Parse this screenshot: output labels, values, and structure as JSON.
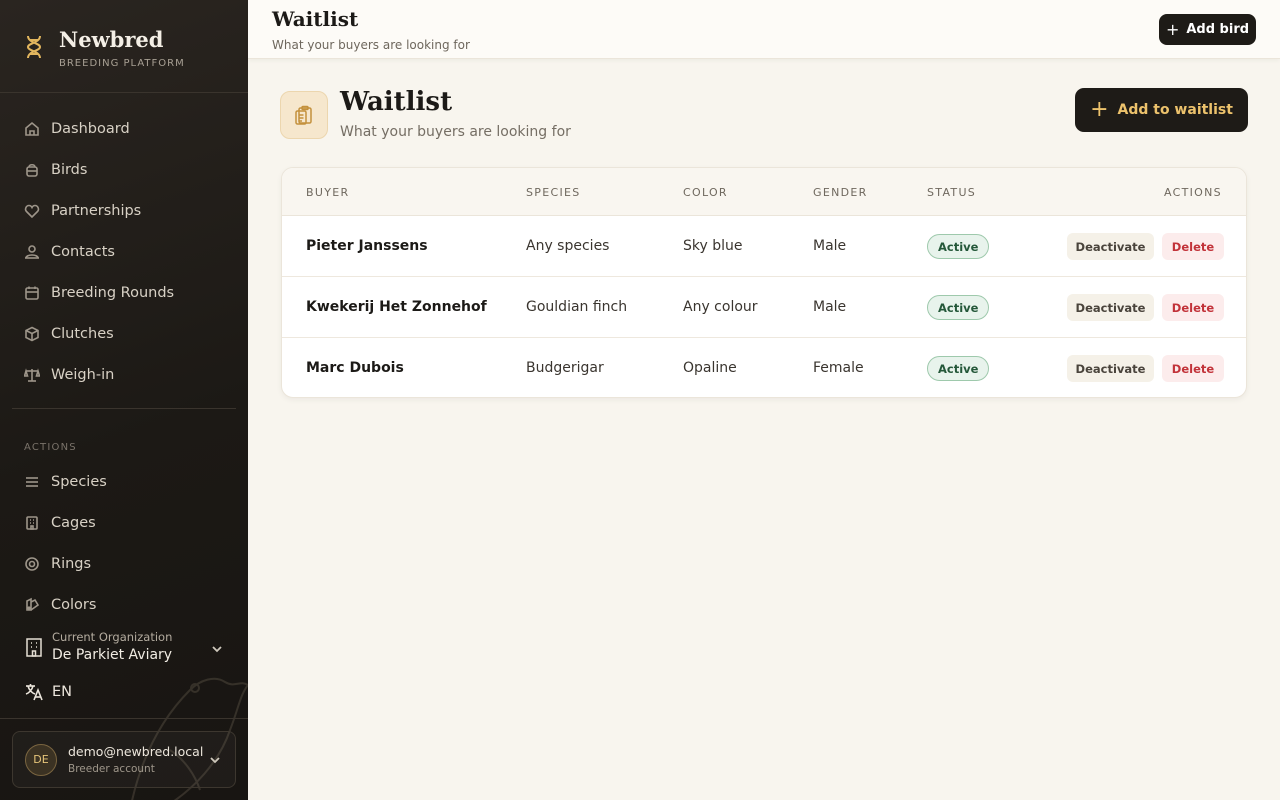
{
  "brand": {
    "name": "Newbred",
    "subtitle": "BREEDING PLATFORM"
  },
  "nav": {
    "items": [
      {
        "label": "Dashboard",
        "icon": "home-icon"
      },
      {
        "label": "Birds",
        "icon": "bird-icon"
      },
      {
        "label": "Partnerships",
        "icon": "heart-icon"
      },
      {
        "label": "Contacts",
        "icon": "contacts-icon"
      },
      {
        "label": "Breeding Rounds",
        "icon": "calendar-icon"
      },
      {
        "label": "Clutches",
        "icon": "box-icon"
      },
      {
        "label": "Weigh-in",
        "icon": "scale-icon"
      }
    ],
    "section_label": "ACTIONS",
    "actions": [
      {
        "label": "Species",
        "icon": "list-icon"
      },
      {
        "label": "Cages",
        "icon": "cage-icon"
      },
      {
        "label": "Rings",
        "icon": "ring-icon"
      },
      {
        "label": "Colors",
        "icon": "palette-icon"
      }
    ]
  },
  "organization": {
    "label": "Current Organization",
    "name": "De Parkiet Aviary"
  },
  "language": {
    "code": "EN"
  },
  "user": {
    "initials": "DE",
    "email": "demo@newbred.local",
    "role": "Breeder account"
  },
  "topbar": {
    "title": "Waitlist",
    "subtitle": "What your buyers are looking for",
    "add_bird_label": "Add bird"
  },
  "page": {
    "title": "Waitlist",
    "subtitle": "What your buyers are looking for",
    "add_label": "Add to waitlist"
  },
  "table": {
    "headers": {
      "buyer": "BUYER",
      "species": "SPECIES",
      "color": "COLOR",
      "gender": "GENDER",
      "status": "STATUS",
      "actions": "ACTIONS"
    },
    "rows": [
      {
        "buyer": "Pieter Janssens",
        "species": "Any species",
        "color": "Sky blue",
        "gender": "Male",
        "status": "Active",
        "deactivate": "Deactivate",
        "delete": "Delete"
      },
      {
        "buyer": "Kwekerij Het Zonnehof",
        "species": "Gouldian finch",
        "color": "Any colour",
        "gender": "Male",
        "status": "Active",
        "deactivate": "Deactivate",
        "delete": "Delete"
      },
      {
        "buyer": "Marc Dubois",
        "species": "Budgerigar",
        "color": "Opaline",
        "gender": "Female",
        "status": "Active",
        "deactivate": "Deactivate",
        "delete": "Delete"
      }
    ]
  },
  "colors": {
    "accent": "#ecc26c",
    "dark": "#1e1b17",
    "active_badge": "#e8f3ec",
    "danger": "#c2333a"
  }
}
